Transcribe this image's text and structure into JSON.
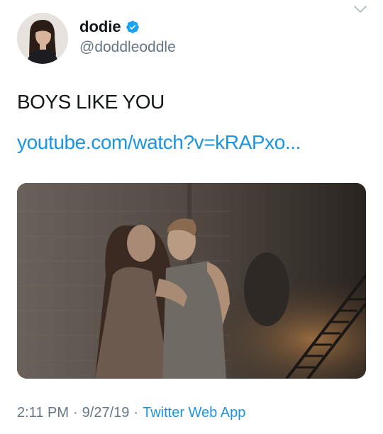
{
  "user": {
    "display_name": "dodie",
    "handle": "@doddleoddle",
    "verified_icon": "verified-badge-icon"
  },
  "tweet": {
    "text": "BOYS LIKE YOU",
    "link_text": "youtube.com/watch?v=kRAPxo..."
  },
  "meta": {
    "time": "2:11 PM",
    "sep1": "·",
    "date": "9/27/19",
    "sep2": "·",
    "source": "Twitter Web App"
  },
  "icons": {
    "menu": "chevron-down-icon"
  },
  "colors": {
    "link": "#1b95e0",
    "secondary_text": "#657786",
    "primary_text": "#14171a",
    "verified": "#1da1f2"
  }
}
